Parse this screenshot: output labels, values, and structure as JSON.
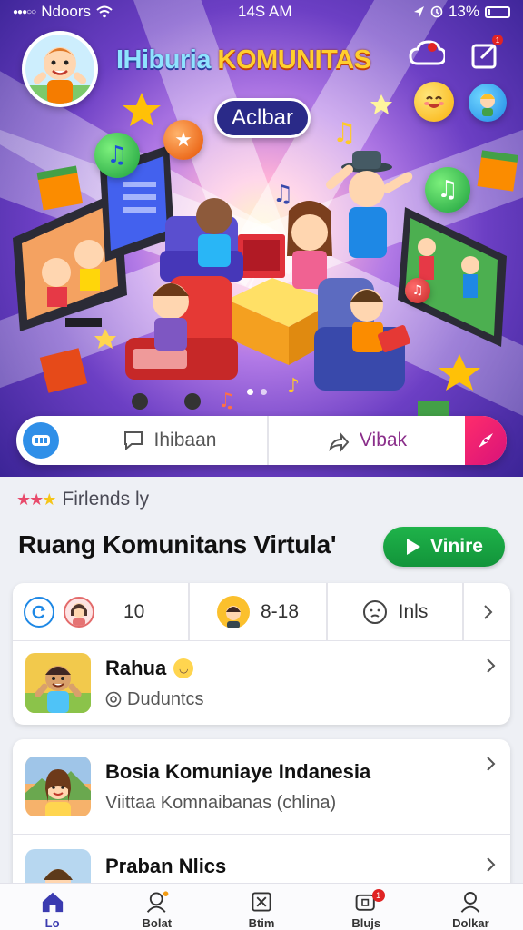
{
  "status_bar": {
    "carrier": "Ndoors",
    "time": "14S AM",
    "battery": "13%",
    "battery_level": 0.13
  },
  "hero": {
    "title_part1": "IHiburia",
    "title_part2": "KOMUNITAS",
    "pill_label": "Aclbar",
    "page_indicator_count": 2,
    "page_indicator_active": 0,
    "notification_badge": "1"
  },
  "action_bar": {
    "first_label": "Ihibaan",
    "second_label": "Vibak"
  },
  "friends": {
    "label": "Firlends ly"
  },
  "section": {
    "title": "Ruang Komunitans Virtula'",
    "join_label": "Vinire"
  },
  "stats": {
    "count_a": "10",
    "range_b": "8-18",
    "label_c": "Inls"
  },
  "rows": [
    {
      "title": "Rahua",
      "subtitle": "Duduntcs"
    },
    {
      "title": "Bosia Komuniaye Indanesia",
      "subtitle": "Viittaa Komnaibanas (chlina)"
    },
    {
      "title": "Praban Nlics",
      "subtitle": ""
    }
  ],
  "nav": {
    "items": [
      {
        "label": "Lo",
        "icon": "home-icon"
      },
      {
        "label": "Bolat",
        "icon": "profile-icon"
      },
      {
        "label": "Btim",
        "icon": "games-icon"
      },
      {
        "label": "Blujs",
        "icon": "notifications-icon"
      },
      {
        "label": "Dolkar",
        "icon": "account-icon"
      }
    ],
    "active_index": 0,
    "badge": "1"
  },
  "colors": {
    "accent_green": "#1fb34a",
    "brand_purple": "#6c3fc4",
    "nav_active": "#3b3bb0",
    "action_red": "#e8196f"
  }
}
